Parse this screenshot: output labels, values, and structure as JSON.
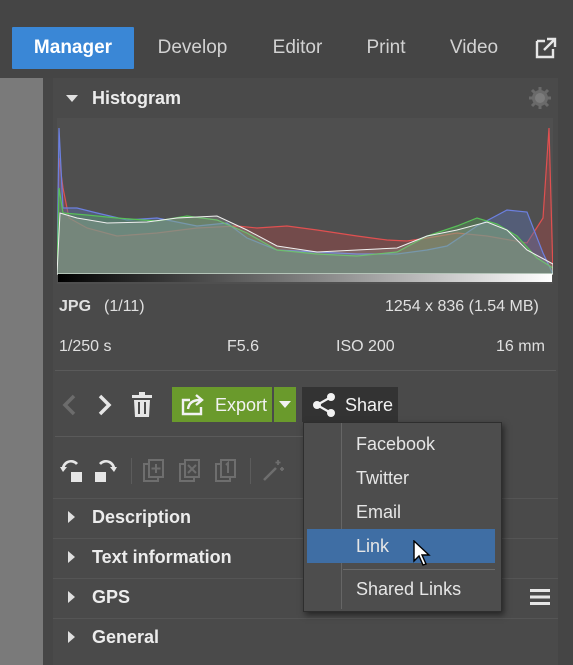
{
  "nav": {
    "tabs": [
      {
        "label": "Manager",
        "active": true
      },
      {
        "label": "Develop",
        "active": false
      },
      {
        "label": "Editor",
        "active": false
      },
      {
        "label": "Print",
        "active": false
      },
      {
        "label": "Video",
        "active": false
      }
    ]
  },
  "histogram": {
    "title": "Histogram"
  },
  "file_info": {
    "format": "JPG",
    "index": "(1/11)",
    "dimensions": "1254 x 836 (1.54 MB)",
    "shutter": "1/250 s",
    "aperture": "F5.6",
    "iso": "ISO 200",
    "focal_length": "16 mm"
  },
  "actions": {
    "export_label": "Export",
    "share_label": "Share"
  },
  "share_menu": {
    "items": [
      "Facebook",
      "Twitter",
      "Email",
      "Link",
      "Shared Links"
    ],
    "highlighted": "Link"
  },
  "sections": [
    {
      "label": "Description"
    },
    {
      "label": "Text information"
    },
    {
      "label": "GPS"
    },
    {
      "label": "General"
    }
  ],
  "colors": {
    "accent_blue": "#3a87d6",
    "export_green": "#6a9a2c",
    "menu_highlight": "#3f6ea4"
  }
}
